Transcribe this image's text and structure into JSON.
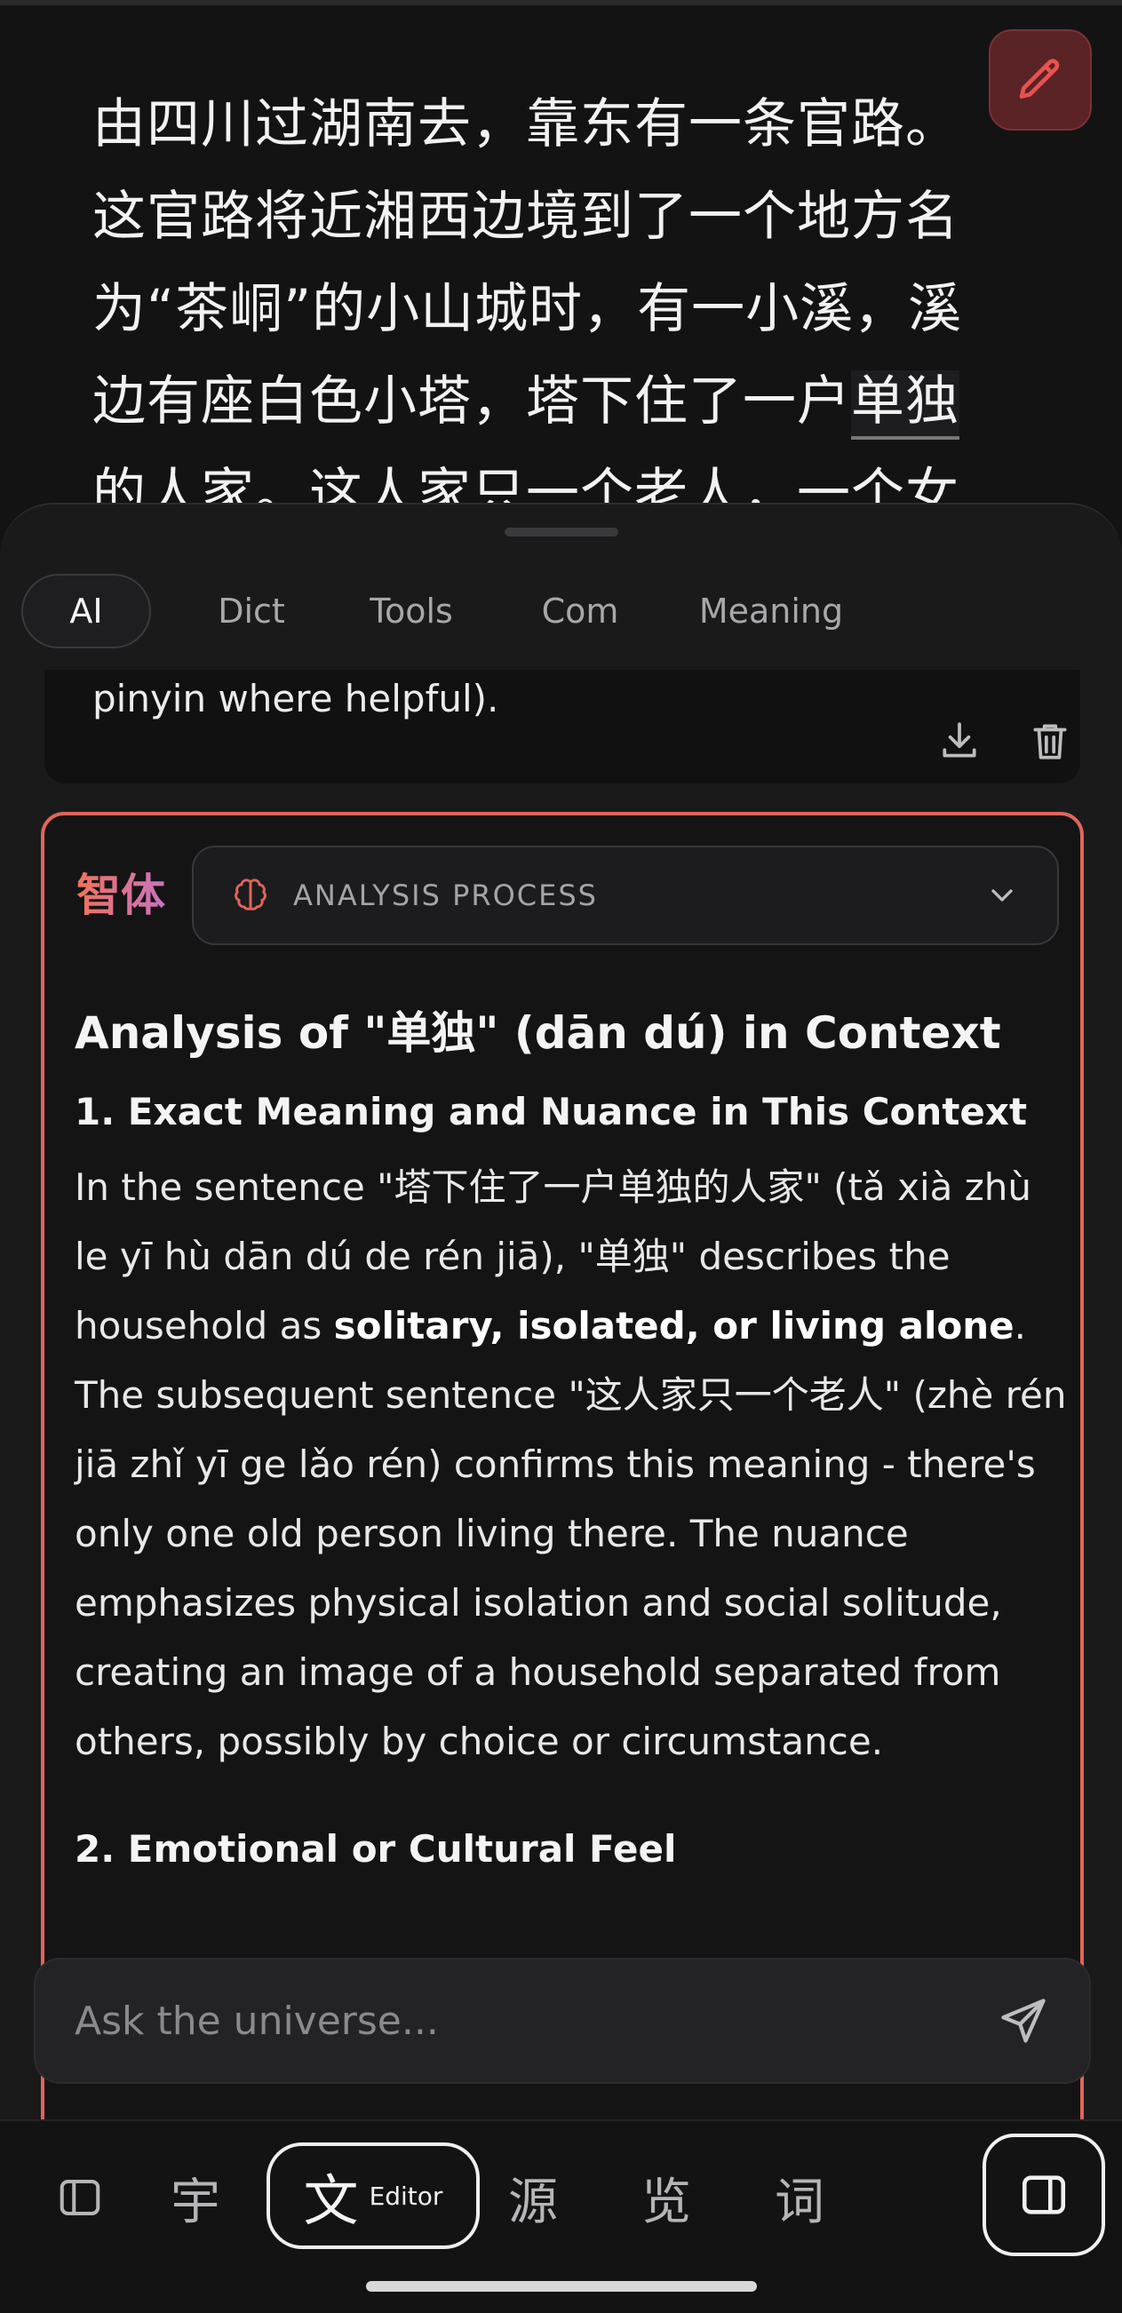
{
  "reader": {
    "line1": "由四川过湖南去，靠东有一条官路。",
    "line2": "这官路将近湘西边境到了一个地方名",
    "line3": "为“茶峒”的小山城时，有一小溪，溪",
    "line4_before": "边有座白色小塔，塔下住了一户",
    "line4_highlight": "单独",
    "line5": "的人家。这人家只一个老人，一个女"
  },
  "tabs": [
    {
      "label": "AI"
    },
    {
      "label": "Dict"
    },
    {
      "label": "Tools"
    },
    {
      "label": "Com"
    },
    {
      "label": "Meaning"
    }
  ],
  "previous_card": {
    "text": "pinyin where helpful)."
  },
  "ai_card": {
    "logo": "智体",
    "analysis_label": "ANALYSIS PROCESS",
    "heading": "Analysis of \"单独\" (dān dú) in Context",
    "section1_title": "1. Exact Meaning and Nuance in This Context",
    "para_part1": "In the sentence \"塔下住了一户单独的人家\" (tǎ xià zhù le yī hù dān dú de rén jiā), \"单独\" describes the household as ",
    "para_bold": "solitary, isolated, or living alone",
    "para_part2": ". The subsequent sentence \"这人家只一个老人\" (zhè rén jiā zhǐ yī ge lǎo rén) confirms this meaning - there's only one old person living there. The nuance emphasizes physical isolation and social solitude, creating an image of a household separated from others, possibly by choice or circumstance.",
    "section2_title": "2. Emotional or Cultural Feel"
  },
  "input": {
    "placeholder": "Ask the universe..."
  },
  "nav": {
    "zi": "宇",
    "wen": "文",
    "editor_label": "Editor",
    "yuan": "源",
    "lan": "览",
    "ci": "词"
  },
  "colors": {
    "accent": "#e0655c",
    "background": "#131314",
    "edit_button": "#5a2326"
  }
}
